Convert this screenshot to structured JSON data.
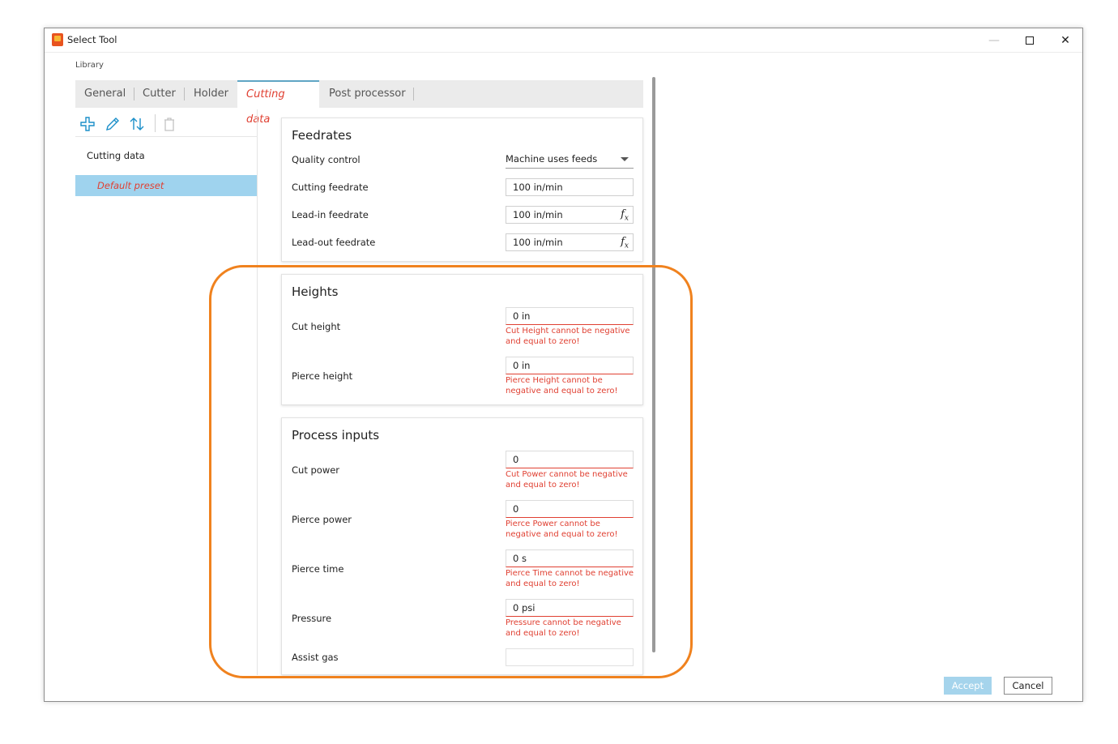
{
  "window": {
    "title": "Select Tool",
    "controls": {
      "minimize": "—",
      "close": "✕"
    }
  },
  "library_label": "Library",
  "tabs": [
    "General",
    "Cutter",
    "Holder",
    "Cutting data",
    "Post processor"
  ],
  "active_tab": "Cutting data",
  "tree": {
    "root": "Cutting data",
    "selected_item": "Default preset"
  },
  "toolbar": {
    "icons": [
      "plus-icon",
      "pencil-icon",
      "sort-icon",
      "trash-icon"
    ]
  },
  "feedrates": {
    "title": "Feedrates",
    "quality_control_label": "Quality control",
    "quality_control_value": "Machine uses feeds",
    "cutting_feedrate_label": "Cutting feedrate",
    "cutting_feedrate_value": "100 in/min",
    "leadin_feedrate_label": "Lead-in feedrate",
    "leadin_feedrate_value": "100 in/min",
    "leadout_feedrate_label": "Lead-out feedrate",
    "leadout_feedrate_value": "100 in/min",
    "fx_label": "f",
    "fx_sub": "x"
  },
  "heights": {
    "title": "Heights",
    "cut_height_label": "Cut height",
    "cut_height_value": "0 in",
    "cut_height_error": "Cut Height cannot be negative and equal to zero!",
    "pierce_height_label": "Pierce height",
    "pierce_height_value": "0 in",
    "pierce_height_error": "Pierce Height cannot be negative and equal to zero!"
  },
  "process_inputs": {
    "title": "Process inputs",
    "cut_power_label": "Cut power",
    "cut_power_value": "0",
    "cut_power_error": "Cut Power cannot be negative and equal to zero!",
    "pierce_power_label": "Pierce power",
    "pierce_power_value": "0",
    "pierce_power_error": "Pierce Power cannot be negative and equal to zero!",
    "pierce_time_label": "Pierce time",
    "pierce_time_value": "0 s",
    "pierce_time_error": "Pierce Time cannot be negative and equal to zero!",
    "pressure_label": "Pressure",
    "pressure_value": "0 psi",
    "pressure_error": "Pressure cannot be negative and equal to zero!",
    "assist_gas_label": "Assist gas",
    "assist_gas_value": ""
  },
  "buttons": {
    "accept": "Accept",
    "cancel": "Cancel"
  },
  "colors": {
    "error": "#e04032",
    "highlight": "#f0821e",
    "selection": "#9fd3ee",
    "accent": "#1b8fc9"
  }
}
